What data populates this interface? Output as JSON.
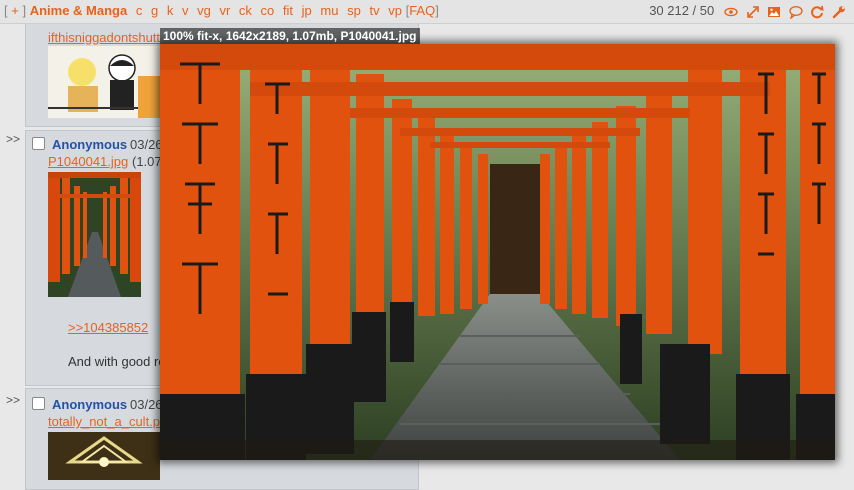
{
  "nav": {
    "open_bracket": "[",
    "home": "+",
    "close_bracket": "]",
    "board_title": "Anime & Manga",
    "boards": [
      "c",
      "g",
      "k",
      "v",
      "vg",
      "vr",
      "ck",
      "co",
      "fit",
      "jp",
      "mu",
      "sp",
      "tv",
      "vp"
    ],
    "faq_open": "[",
    "faq": "FAQ",
    "faq_close": "]",
    "stats": "30 212 / 50",
    "icons": [
      "eye-icon",
      "expand-icon",
      "image-icon",
      "chat-icon",
      "refresh-icon",
      "wrench-icon"
    ]
  },
  "posts": [
    {
      "filename": "ifthisniggadontshutt",
      "thumb_desc": "manga"
    },
    {
      "arrows": ">>",
      "name": "Anonymous",
      "date": "03/26",
      "filename": "P1040041.jpg",
      "filesize": "(1.07",
      "quote": ">>104385852",
      "text": "And with good re"
    },
    {
      "arrows": ">>",
      "name": "Anonymous",
      "date": "03/26",
      "filename": "totally_not_a_cult.p"
    }
  ],
  "hover": {
    "caption": "100% fit-x, 1642x2189, 1.07mb, P1040041.jpg"
  },
  "colors": {
    "link": "#e8621b",
    "name": "#2352a8",
    "torii": "#e2500f",
    "page_bg": "#e8e8e8",
    "post_bg": "#d6dade"
  }
}
